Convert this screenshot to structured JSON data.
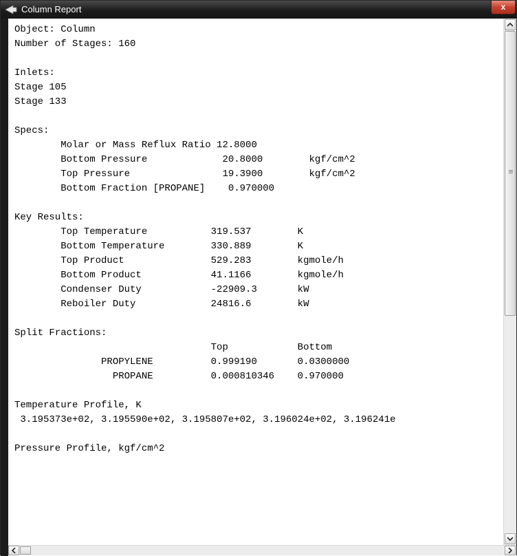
{
  "window": {
    "title": "Column Report",
    "close_label": "x",
    "icon": "app-arrow-icon"
  },
  "report": {
    "lines": [
      "Object: Column",
      "Number of Stages: 160",
      "",
      "Inlets:",
      "Stage 105",
      "Stage 133",
      "",
      "Specs:",
      "        Molar or Mass Reflux Ratio 12.8000",
      "        Bottom Pressure             20.8000        kgf/cm^2",
      "        Top Pressure                19.3900        kgf/cm^2",
      "        Bottom Fraction [PROPANE]    0.970000",
      "",
      "Key Results:",
      "        Top Temperature           319.537        K",
      "        Bottom Temperature        330.889        K",
      "        Top Product               529.283        kgmole/h",
      "        Bottom Product            41.1166        kgmole/h",
      "        Condenser Duty            -22909.3       kW",
      "        Reboiler Duty             24816.6        kW",
      "",
      "Split Fractions:",
      "                                  Top            Bottom",
      "               PROPYLENE          0.999190       0.0300000",
      "                 PROPANE          0.000810346    0.970000",
      "",
      "Temperature Profile, K",
      " 3.195373e+02, 3.195590e+02, 3.195807e+02, 3.196024e+02, 3.196241e",
      "",
      "Pressure Profile, kgf/cm^2"
    ]
  },
  "scrollbars": {
    "vertical": {
      "up_icon": "scroll-up-arrow-icon",
      "down_icon": "scroll-down-arrow-icon"
    },
    "horizontal": {
      "left_icon": "scroll-left-arrow-icon",
      "right_icon": "scroll-right-arrow-icon"
    }
  },
  "colors": {
    "titlebar": "#1c1c1c",
    "close_button": "#c7412c",
    "background": "#ffffff"
  }
}
